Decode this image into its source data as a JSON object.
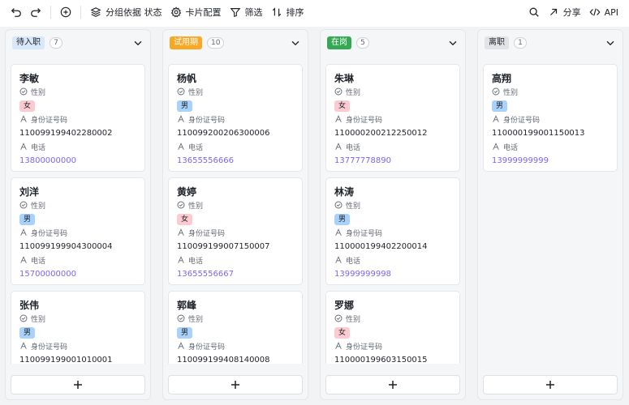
{
  "toolbar": {
    "undo_icon": "undo-icon",
    "redo_icon": "redo-icon",
    "add_icon": "plus-icon",
    "group_label": "分组依据 状态",
    "card_config_label": "卡片配置",
    "filter_label": "筛选",
    "sort_label": "排序",
    "share_label": "分享",
    "api_label": "API"
  },
  "field_labels": {
    "gender": "性别",
    "id": "身份证号码",
    "phone": "电话"
  },
  "colors": {
    "tag_pending": "#d9e7fb",
    "tag_trial": "#f9a825",
    "tag_active": "#34a853",
    "tag_left": "#e1e3e6",
    "male": "#a9d2fb",
    "female": "#fbcbd1",
    "phone_link": "#7b67ee"
  },
  "columns": [
    {
      "status": "待入职",
      "count": "7",
      "cards": [
        {
          "name": "李敏",
          "gender": "女",
          "id": "110099199402280002",
          "phone": "13800000000"
        },
        {
          "name": "刘洋",
          "gender": "男",
          "id": "110099199904300004",
          "phone": "15700000000"
        },
        {
          "name": "张伟",
          "gender": "男",
          "id": "110099199001010001",
          "phone": ""
        }
      ]
    },
    {
      "status": "试用期",
      "count": "10",
      "cards": [
        {
          "name": "杨帆",
          "gender": "男",
          "id": "110099200206300006",
          "phone": "13655556666"
        },
        {
          "name": "黄婷",
          "gender": "女",
          "id": "110099199007150007",
          "phone": "13655556667"
        },
        {
          "name": "郭峰",
          "gender": "男",
          "id": "110099199408140008",
          "phone": ""
        }
      ]
    },
    {
      "status": "在岗",
      "count": "5",
      "cards": [
        {
          "name": "朱琳",
          "gender": "女",
          "id": "110000200212250012",
          "phone": "13777778890"
        },
        {
          "name": "林涛",
          "gender": "男",
          "id": "110000199402200014",
          "phone": "13999999998"
        },
        {
          "name": "罗娜",
          "gender": "女",
          "id": "110000199603150015",
          "phone": ""
        }
      ]
    },
    {
      "status": "离职",
      "count": "1",
      "cards": [
        {
          "name": "高翔",
          "gender": "男",
          "id": "110000199001150013",
          "phone": "13999999999"
        }
      ]
    }
  ]
}
